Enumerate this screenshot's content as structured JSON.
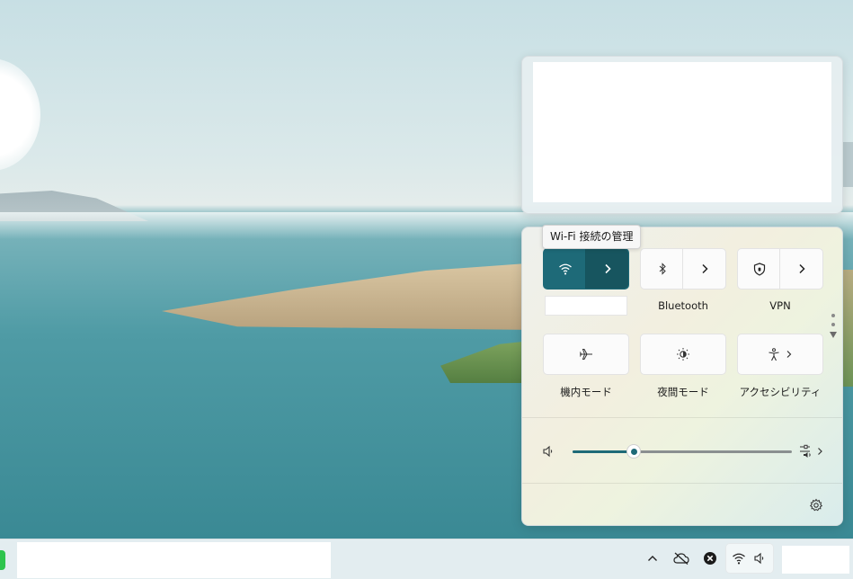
{
  "tooltip": {
    "text": "Wi-Fi 接続の管理"
  },
  "quick_settings": {
    "tiles_row1": [
      {
        "id": "wifi",
        "label": "",
        "icon": "wifi-icon",
        "state": "on",
        "chevron": true
      },
      {
        "id": "bluetooth",
        "label": "Bluetooth",
        "icon": "bluetooth-icon",
        "state": "off",
        "chevron": true
      },
      {
        "id": "vpn",
        "label": "VPN",
        "icon": "shield-icon",
        "state": "off",
        "chevron": true
      }
    ],
    "tiles_row2": [
      {
        "id": "airplane",
        "label": "機内モード",
        "icon": "airplane-icon",
        "state": "off"
      },
      {
        "id": "night_light",
        "label": "夜間モード",
        "icon": "night-light-icon",
        "state": "off"
      },
      {
        "id": "accessibility",
        "label": "アクセシビリティ",
        "icon": "accessibility-icon",
        "state": "off",
        "chevron": true
      }
    ],
    "volume": {
      "level": 0.28,
      "icon": "speaker-icon",
      "mixer_icon": "audio-mixer-icon"
    },
    "settings_icon": "gear-icon"
  },
  "taskbar": {
    "tray_icons": [
      "chevron-up-icon",
      "onedrive-offline-icon",
      "close-circle-icon",
      "wifi-icon",
      "speaker-icon"
    ]
  },
  "colors": {
    "accent": "#1e6a78",
    "accent_dark": "#17555f"
  }
}
